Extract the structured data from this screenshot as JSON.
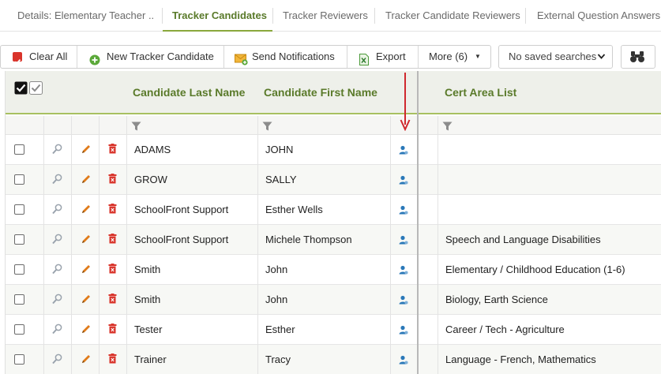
{
  "tabs": [
    {
      "label": "Details: Elementary Teacher ..."
    },
    {
      "label": "Tracker Candidates"
    },
    {
      "label": "Tracker Reviewers"
    },
    {
      "label": "Tracker Candidate Reviewers"
    },
    {
      "label": "External Question Answers"
    }
  ],
  "toolbar": {
    "clear_all": "Clear All",
    "new_candidate": "New Tracker Candidate",
    "send_notifications": "Send Notifications",
    "export": "Export",
    "more": "More (6)",
    "saved_searches": "No saved searches"
  },
  "columns": {
    "last_name": "Candidate Last Name",
    "first_name": "Candidate First Name",
    "cert_area": "Cert Area List"
  },
  "rows": [
    {
      "last": "ADAMS",
      "first": "JOHN",
      "cert": ""
    },
    {
      "last": "GROW",
      "first": "SALLY",
      "cert": ""
    },
    {
      "last": "SchoolFront Support",
      "first": "Esther Wells",
      "cert": ""
    },
    {
      "last": "SchoolFront Support",
      "first": "Michele Thompson",
      "cert": "Speech and Language Disabilities"
    },
    {
      "last": "Smith",
      "first": "John",
      "cert": "Elementary / Childhood Education (1-6)"
    },
    {
      "last": "Smith",
      "first": "John",
      "cert": "Biology, Earth Science"
    },
    {
      "last": "Tester",
      "first": "Esther",
      "cert": "Career / Tech - Agriculture"
    },
    {
      "last": "Trainer",
      "first": "Tracy",
      "cert": "Language - French, Mathematics"
    }
  ],
  "colors": {
    "accent": "#5a7a2a",
    "accent_line": "#a8c060",
    "delete_red": "#d9342b",
    "edit_orange": "#e07b1a",
    "arrow_red": "#d0282e"
  }
}
